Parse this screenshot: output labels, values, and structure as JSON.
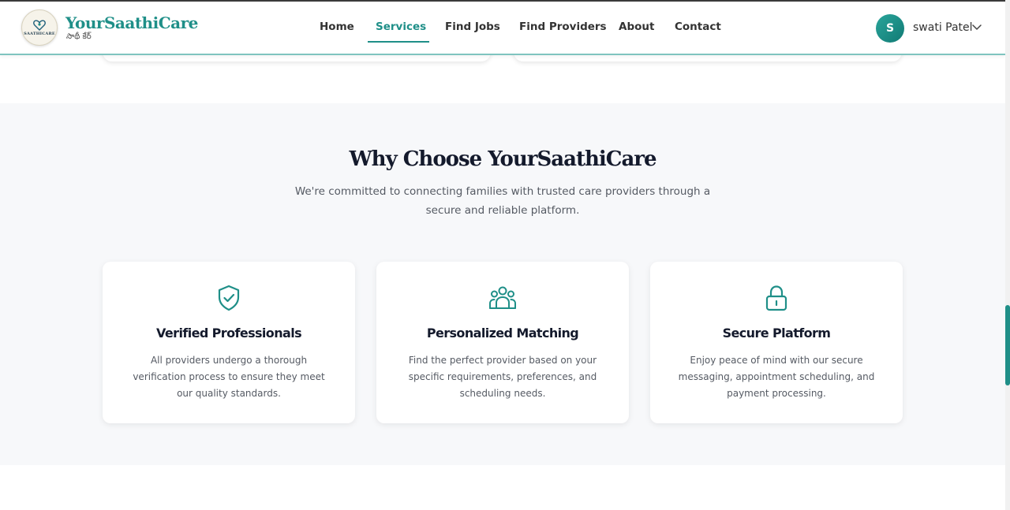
{
  "header": {
    "brand_name": "YourSaathiCare",
    "brand_subtitle": "సాథీ కేర్",
    "logo_text": "SAATHICARE",
    "nav": [
      {
        "label": "Home",
        "active": false
      },
      {
        "label": "Services",
        "active": true
      },
      {
        "label": "Find Jobs",
        "active": false
      },
      {
        "label": "Find Providers",
        "active": false
      },
      {
        "label": "About",
        "active": false
      },
      {
        "label": "Contact",
        "active": false
      }
    ],
    "user": {
      "initial": "S",
      "name": "swati Patel"
    }
  },
  "why_section": {
    "title": "Why Choose YourSaathiCare",
    "subtitle": "We're committed to connecting families with trusted care providers through a secure and reliable platform.",
    "cards": [
      {
        "icon": "shield-check-icon",
        "title": "Verified Professionals",
        "description": "All providers undergo a thorough verification process to ensure they meet our quality standards."
      },
      {
        "icon": "users-icon",
        "title": "Personalized Matching",
        "description": "Find the perfect provider based on your specific requirements, preferences, and scheduling needs."
      },
      {
        "icon": "lock-icon",
        "title": "Secure Platform",
        "description": "Enjoy peace of mind with our secure messaging, appointment scheduling, and payment processing."
      }
    ]
  },
  "colors": {
    "brand": "#1f8f88",
    "heading": "#141a2c",
    "body_text": "#555a63",
    "section_bg": "#f7f8fa"
  }
}
